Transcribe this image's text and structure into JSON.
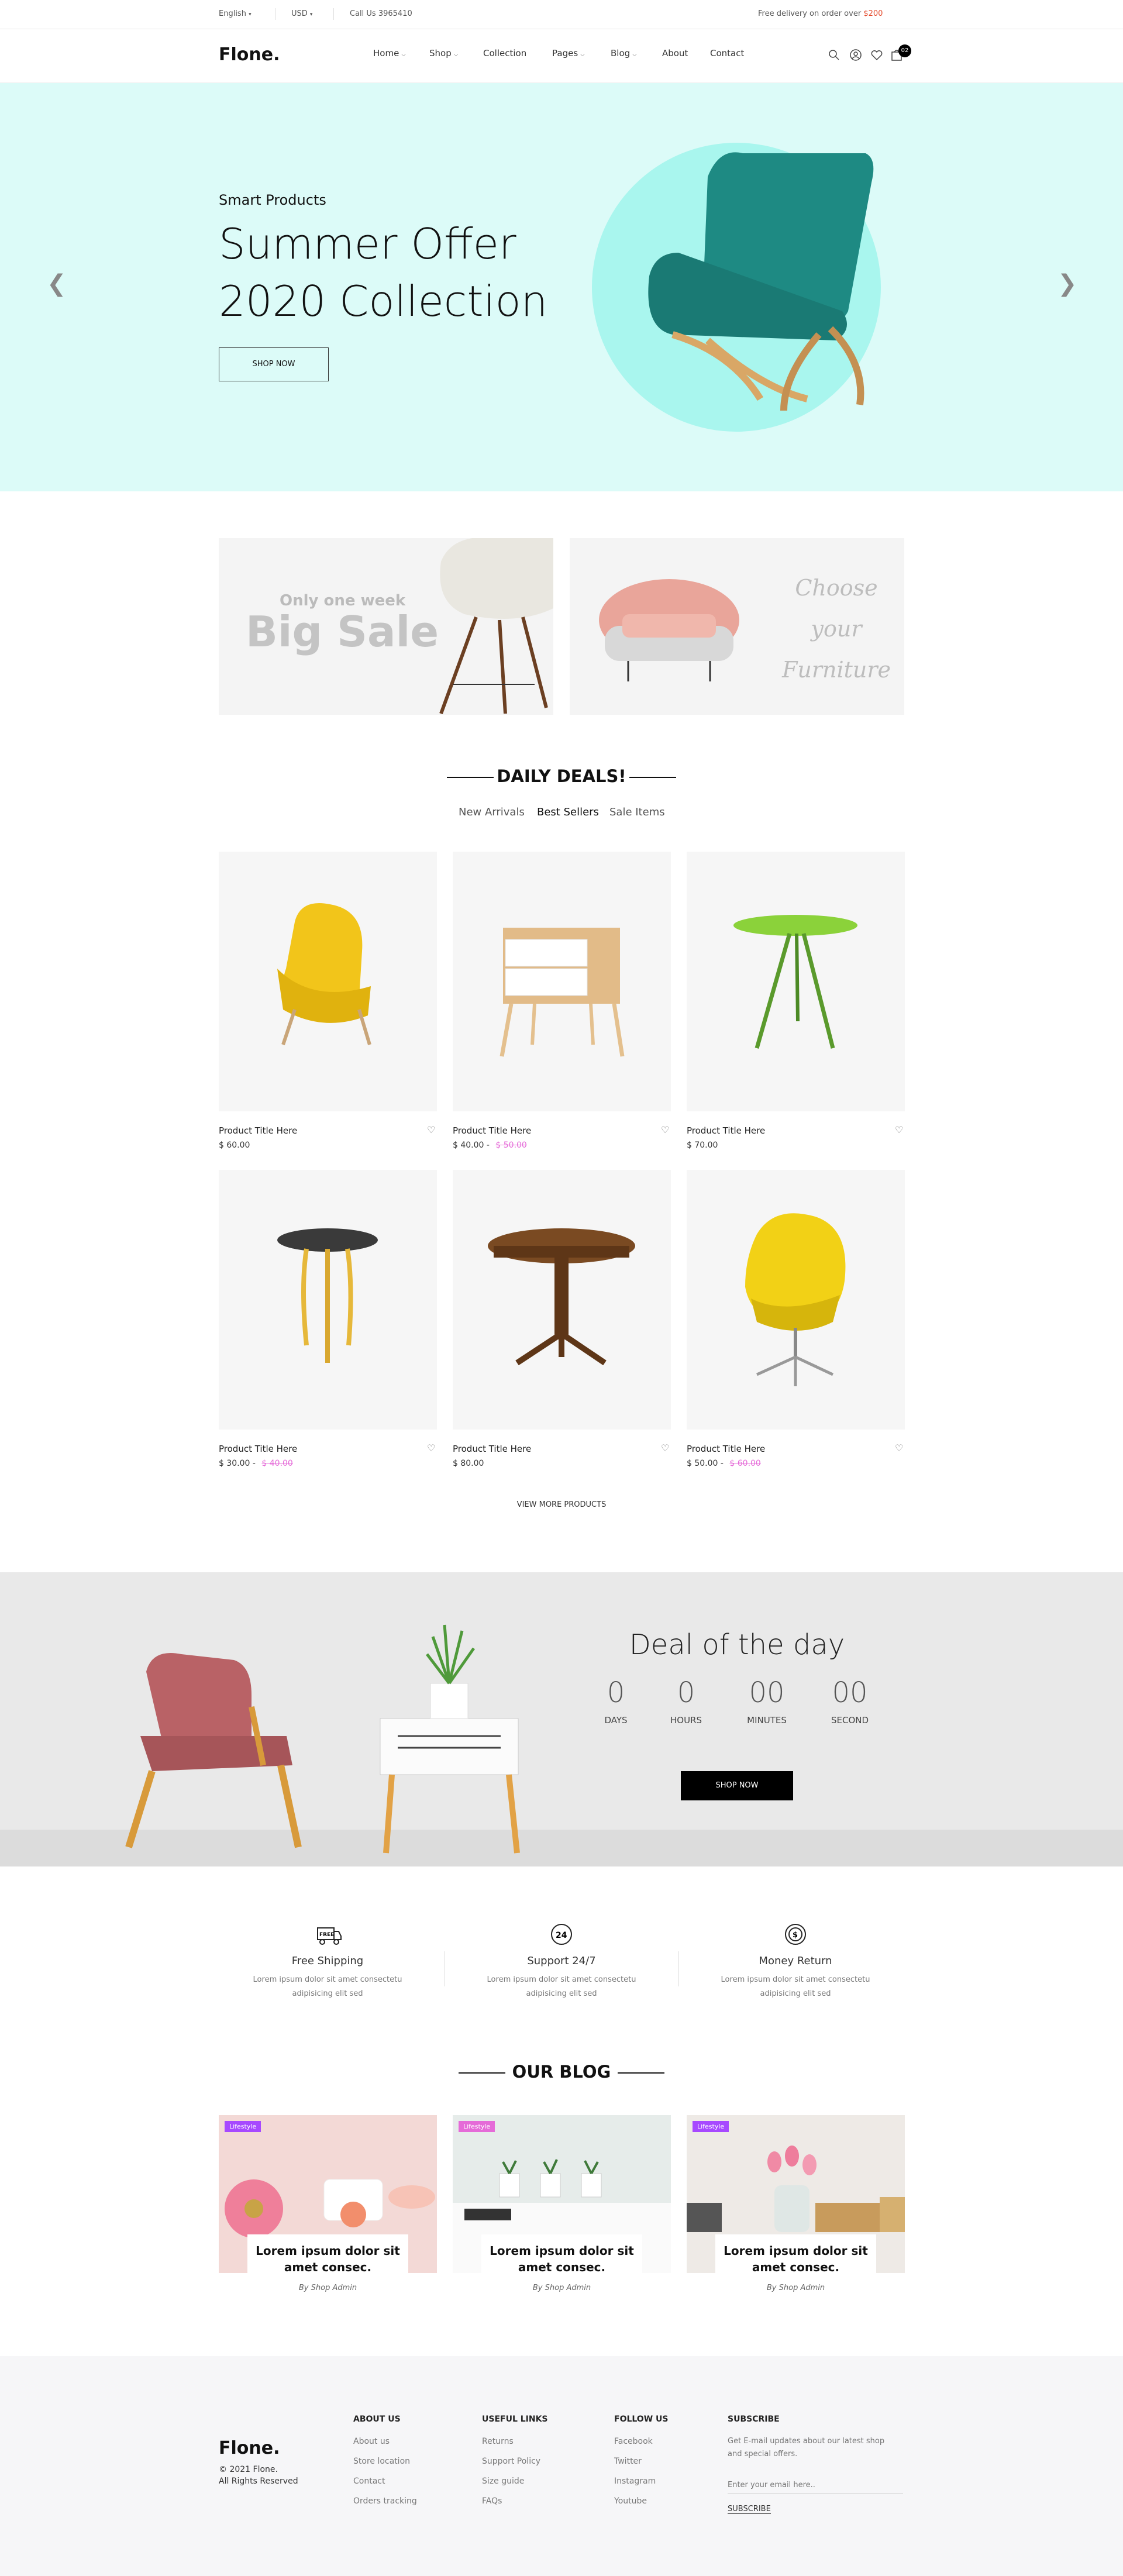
{
  "topbar": {
    "language": "English",
    "currency": "USD",
    "phone": "Call Us 3965410",
    "delivery_text": "Free delivery on order over",
    "delivery_amount": "$200"
  },
  "header": {
    "logo": "Flone.",
    "nav": [
      "Home",
      "Shop",
      "Collection",
      "Pages",
      "Blog",
      "About",
      "Contact"
    ],
    "cart_count": "02"
  },
  "hero": {
    "subtitle": "Smart Products",
    "title_line1": "Summer Offer",
    "title_line2": "2020 Collection",
    "button": "SHOP NOW"
  },
  "banners": {
    "left_small": "Only one week",
    "left_big": "Big Sale",
    "right_line1": "Choose",
    "right_line2": "your",
    "right_line3": "Furniture"
  },
  "deals": {
    "title": "DAILY DEALS!",
    "tabs": [
      "New Arrivals",
      "Best Sellers",
      "Sale Items"
    ],
    "active_tab": "Best Sellers",
    "products": [
      {
        "name": "Product Title Here",
        "price": "$ 60.00",
        "old": ""
      },
      {
        "name": "Product Title Here",
        "price": "$ 40.00",
        "old": "$ 50.00"
      },
      {
        "name": "Product Title Here",
        "price": "$ 70.00",
        "old": ""
      },
      {
        "name": "Product Title Here",
        "price": "$ 30.00",
        "old": "$ 40.00"
      },
      {
        "name": "Product Title Here",
        "price": "$ 80.00",
        "old": ""
      },
      {
        "name": "Product Title Here",
        "price": "$ 50.00",
        "old": "$ 60.00"
      }
    ],
    "view_more": "VIEW MORE PRODUCTS",
    "colors": {
      "accent": "#a749ff",
      "old_price": "#e56bd8",
      "hero_bg": "#dcfbf8"
    }
  },
  "deal_of_day": {
    "title": "Deal of the day",
    "counters": [
      {
        "value": "0",
        "label": "DAYS"
      },
      {
        "value": "0",
        "label": "HOURS"
      },
      {
        "value": "00",
        "label": "MINUTES"
      },
      {
        "value": "00",
        "label": "SECOND"
      }
    ],
    "button": "SHOP NOW"
  },
  "features": [
    {
      "icon": "truck-free-icon",
      "title": "Free Shipping",
      "desc1": "Lorem ipsum dolor sit amet consectetu",
      "desc2": "adipisicing elit sed"
    },
    {
      "icon": "support-24-icon",
      "title": "Support 24/7",
      "desc1": "Lorem ipsum dolor sit amet consectetu",
      "desc2": "adipisicing elit sed"
    },
    {
      "icon": "money-return-icon",
      "title": "Money Return",
      "desc1": "Lorem ipsum dolor sit amet consectetu",
      "desc2": "adipisicing elit sed"
    }
  ],
  "blog": {
    "title": "OUR BLOG",
    "posts": [
      {
        "tag": "Lifestyle",
        "line1": "Lorem ipsum dolor sit",
        "line2": "amet consec.",
        "by": "By Shop Admin"
      },
      {
        "tag": "Lifestyle",
        "line1": "Lorem ipsum dolor sit",
        "line2": "amet consec.",
        "by": "By Shop Admin"
      },
      {
        "tag": "Lifestyle",
        "line1": "Lorem ipsum dolor sit",
        "line2": "amet consec.",
        "by": "By Shop Admin"
      }
    ]
  },
  "footer": {
    "logo": "Flone.",
    "copyright1": "© 2021 Flone.",
    "copyright2": "All Rights Reserved",
    "about_title": "ABOUT US",
    "about": [
      "About us",
      "Store location",
      "Contact",
      "Orders tracking"
    ],
    "useful_title": "USEFUL LINKS",
    "useful": [
      "Returns",
      "Support Policy",
      "Size guide",
      "FAQs"
    ],
    "follow_title": "FOLLOW US",
    "follow": [
      "Facebook",
      "Twitter",
      "Instagram",
      "Youtube"
    ],
    "subscribe_title": "SUBSCRIBE",
    "subscribe_text1": "Get E-mail updates about our latest shop",
    "subscribe_text2": "and special offers.",
    "email_placeholder": "Enter your email here..",
    "subscribe_button": "SUBSCRIBE"
  }
}
